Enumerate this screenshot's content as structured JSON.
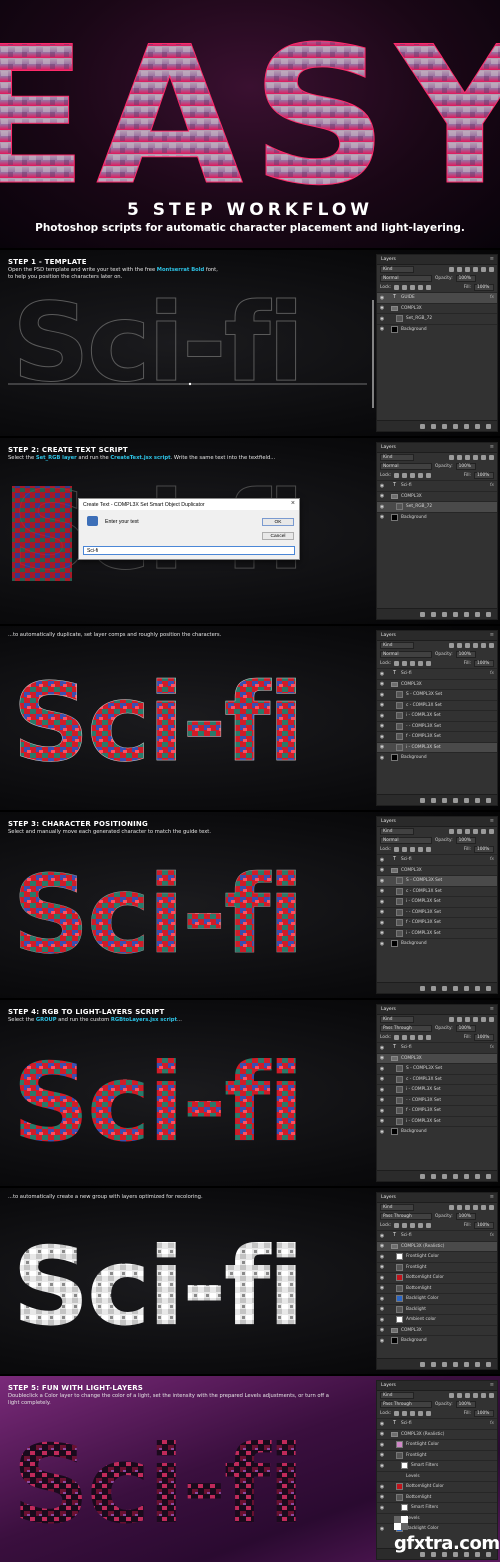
{
  "header": {
    "big_word": "EASY",
    "title": "5 STEP WORKFLOW",
    "subtitle": "Photoshop scripts for automatic character placement and light-layering."
  },
  "steps": [
    {
      "title": "STEP 1 - TEMPLATE",
      "desc_parts": [
        "Open the PSD template and write your text with the free ",
        "Montserrat Bold",
        " font,",
        "to help you position the characters later on."
      ],
      "canvas_text": "Sci-fi"
    },
    {
      "title": "STEP 2: CREATE TEXT SCRIPT",
      "desc_parts": [
        "Select the ",
        "Set_RGB layer",
        " and run the ",
        "CreateText.jsx script",
        ". Write the same text into the textfield..."
      ],
      "canvas_text": "Sci-fi"
    },
    {
      "title": "",
      "desc": "...to automatically duplicate, set layer comps and roughly position the characters.",
      "canvas_text": "Sci-fi"
    },
    {
      "title": "STEP 3: CHARACTER POSITIONING",
      "desc": "Select and manually move each generated character to match the guide text.",
      "canvas_text": "Sci-fi"
    },
    {
      "title": "STEP 4: RGB TO LIGHT-LAYERS SCRIPT",
      "desc_parts": [
        "Select the ",
        "GROUP",
        " and run the custom ",
        "RGBtoLayers.jsx script",
        "..."
      ],
      "canvas_text": "Sci-fi"
    },
    {
      "title": "",
      "desc": "...to automatically create a new group with layers optimized for recoloring.",
      "canvas_text": "Sci-fi"
    },
    {
      "title": "STEP 5: FUN WITH LIGHT-LAYERS",
      "desc": "Doubleclick a Color layer to change the color of a light, set the intensity with the prepared Levels adjustments, or turn off a light completely.",
      "canvas_text": "Sci-fi"
    }
  ],
  "dialog": {
    "title": "Create Text - COMPL3X Set Smart Object Duplicator",
    "close": "×",
    "label": "Enter your text",
    "ok": "OK",
    "cancel": "Cancel",
    "input_value": "Sci-fi"
  },
  "layers_common": {
    "tab": "Layers",
    "kind": "Kind",
    "blend_normal": "Normal",
    "blend_pass": "Pass Through",
    "opacity_label": "Opacity:",
    "opacity": "100%",
    "lock_label": "Lock:",
    "fill_label": "Fill:",
    "fill": "100%",
    "fx": "fx"
  },
  "panels": [
    {
      "blend": "Normal",
      "layers": [
        {
          "name": "GUIDE",
          "thumb": "text",
          "indent": 0,
          "sel": true,
          "fx": true
        },
        {
          "name": "COMPL3X",
          "thumb": "folder",
          "indent": 0
        },
        {
          "name": "Set_RGB_72",
          "thumb": "img",
          "indent": 1
        },
        {
          "name": "Background",
          "thumb": "black",
          "indent": 0
        }
      ]
    },
    {
      "blend": "Normal",
      "layers": [
        {
          "name": "Sci-fi",
          "thumb": "text",
          "indent": 0,
          "fx": true
        },
        {
          "name": "COMPL3X",
          "thumb": "folder",
          "indent": 0
        },
        {
          "name": "Set_RGB_72",
          "thumb": "img",
          "indent": 1,
          "sel": true
        },
        {
          "name": "Background",
          "thumb": "black",
          "indent": 0
        }
      ]
    },
    {
      "blend": "Normal",
      "layers": [
        {
          "name": "Sci-fi",
          "thumb": "text",
          "indent": 0,
          "fx": true
        },
        {
          "name": "COMPL3X",
          "thumb": "folder",
          "indent": 0
        },
        {
          "name": "S - COMPL3X Set",
          "thumb": "img",
          "indent": 1
        },
        {
          "name": "c - COMPL3X Set",
          "thumb": "img",
          "indent": 1
        },
        {
          "name": "i - COMPL3X Set",
          "thumb": "img",
          "indent": 1
        },
        {
          "name": "- - COMPL3X Set",
          "thumb": "img",
          "indent": 1
        },
        {
          "name": "f - COMPL3X Set",
          "thumb": "img",
          "indent": 1
        },
        {
          "name": "i - COMPL3X Set",
          "thumb": "img",
          "indent": 1,
          "sel": true
        },
        {
          "name": "Background",
          "thumb": "black",
          "indent": 0
        }
      ]
    },
    {
      "blend": "Normal",
      "layers": [
        {
          "name": "Sci-fi",
          "thumb": "text",
          "indent": 0,
          "fx": true
        },
        {
          "name": "COMPL3X",
          "thumb": "folder",
          "indent": 0
        },
        {
          "name": "S - COMPL3X Set",
          "thumb": "img",
          "indent": 1,
          "sel": true
        },
        {
          "name": "c - COMPL3X Set",
          "thumb": "img",
          "indent": 1
        },
        {
          "name": "i - COMPL3X Set",
          "thumb": "img",
          "indent": 1
        },
        {
          "name": "- - COMPL3X Set",
          "thumb": "img",
          "indent": 1
        },
        {
          "name": "f - COMPL3X Set",
          "thumb": "img",
          "indent": 1
        },
        {
          "name": "i - COMPL3X Set",
          "thumb": "img",
          "indent": 1
        },
        {
          "name": "Background",
          "thumb": "black",
          "indent": 0
        }
      ]
    },
    {
      "blend": "Pass Through",
      "layers": [
        {
          "name": "Sci-fi",
          "thumb": "text",
          "indent": 0,
          "fx": true
        },
        {
          "name": "COMPL3X",
          "thumb": "folder",
          "indent": 0,
          "sel": true
        },
        {
          "name": "S - COMPL3X Set",
          "thumb": "img",
          "indent": 1
        },
        {
          "name": "c - COMPL3X Set",
          "thumb": "img",
          "indent": 1
        },
        {
          "name": "i - COMPL3X Set",
          "thumb": "img",
          "indent": 1
        },
        {
          "name": "- - COMPL3X Set",
          "thumb": "img",
          "indent": 1
        },
        {
          "name": "f - COMPL3X Set",
          "thumb": "img",
          "indent": 1
        },
        {
          "name": "i - COMPL3X Set",
          "thumb": "img",
          "indent": 1
        },
        {
          "name": "Background",
          "thumb": "black",
          "indent": 0
        }
      ]
    },
    {
      "blend": "Pass Through",
      "layers": [
        {
          "name": "Sci-fi",
          "thumb": "text",
          "indent": 0,
          "fx": true
        },
        {
          "name": "COMPL3X (Realistic)",
          "thumb": "folder",
          "indent": 0,
          "sel": true
        },
        {
          "name": "Frontlight Color",
          "thumb": "white",
          "indent": 1
        },
        {
          "name": "Frontlight",
          "thumb": "img",
          "indent": 1
        },
        {
          "name": "Bottomlight Color",
          "thumb": "red",
          "indent": 1
        },
        {
          "name": "Bottomlight",
          "thumb": "img",
          "indent": 1
        },
        {
          "name": "Backlight Color",
          "thumb": "blue",
          "indent": 1
        },
        {
          "name": "Backlight",
          "thumb": "img",
          "indent": 1
        },
        {
          "name": "Ambient color",
          "thumb": "white",
          "indent": 1
        },
        {
          "name": "COMPL3X",
          "thumb": "folder",
          "indent": 0
        },
        {
          "name": "Background",
          "thumb": "black",
          "indent": 0
        }
      ]
    },
    {
      "blend": "Pass Through",
      "layers": [
        {
          "name": "Sci-fi",
          "thumb": "text",
          "indent": 0,
          "fx": true
        },
        {
          "name": "COMPL3X (Realistic)",
          "thumb": "folder",
          "indent": 0
        },
        {
          "name": "Frontlight Color",
          "thumb": "pink",
          "indent": 1
        },
        {
          "name": "Frontlight",
          "thumb": "img",
          "indent": 1
        },
        {
          "name": "Smart Filters",
          "thumb": "white",
          "indent": 2
        },
        {
          "name": "Levels",
          "thumb": "none",
          "indent": 3
        },
        {
          "name": "Bottomlight Color",
          "thumb": "red",
          "indent": 1
        },
        {
          "name": "Bottomlight",
          "thumb": "img",
          "indent": 1
        },
        {
          "name": "Smart Filters",
          "thumb": "white",
          "indent": 2
        },
        {
          "name": "Levels",
          "thumb": "none",
          "indent": 3
        },
        {
          "name": "Backlight Color",
          "thumb": "blue",
          "indent": 1
        }
      ]
    }
  ],
  "watermark": "gfxtra.com",
  "colors": {
    "accent_cyan": "#2ec4e6",
    "ps_panel": "#323232",
    "red_char": "#d01c28",
    "step5_bg": "#5a1a5e"
  }
}
